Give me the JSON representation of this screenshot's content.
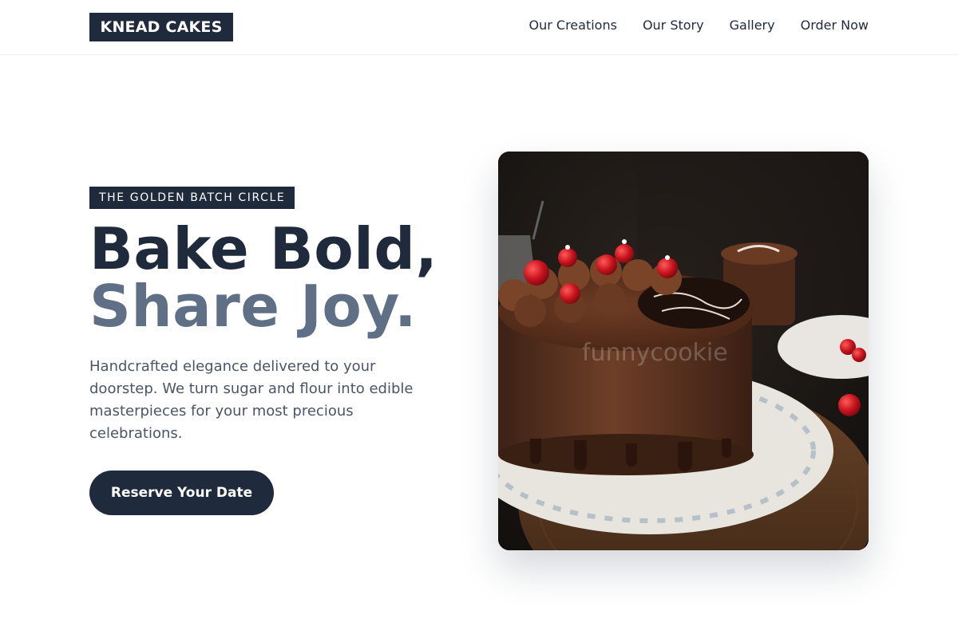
{
  "brand": {
    "logo_text": "KNEAD CAKES"
  },
  "nav": {
    "links": [
      {
        "label": "Our Creations"
      },
      {
        "label": "Our Story"
      },
      {
        "label": "Gallery"
      },
      {
        "label": "Order Now"
      }
    ]
  },
  "hero": {
    "badge": "THE GOLDEN BATCH CIRCLE",
    "headline_line1": "Bake Bold,",
    "headline_line2": "Share Joy.",
    "description": "Handcrafted elegance delivered to your doorstep. We turn sugar and flour into edible masterpieces for your most precious celebrations.",
    "cta_label": "Reserve Your Date",
    "image": {
      "subject": "chocolate-cake-photo",
      "watermark": "funnycookie"
    }
  },
  "colors": {
    "primary": "#1f2a3d",
    "accent_text": "#5f6f86",
    "body_text": "#4a5568",
    "background": "#ffffff"
  }
}
